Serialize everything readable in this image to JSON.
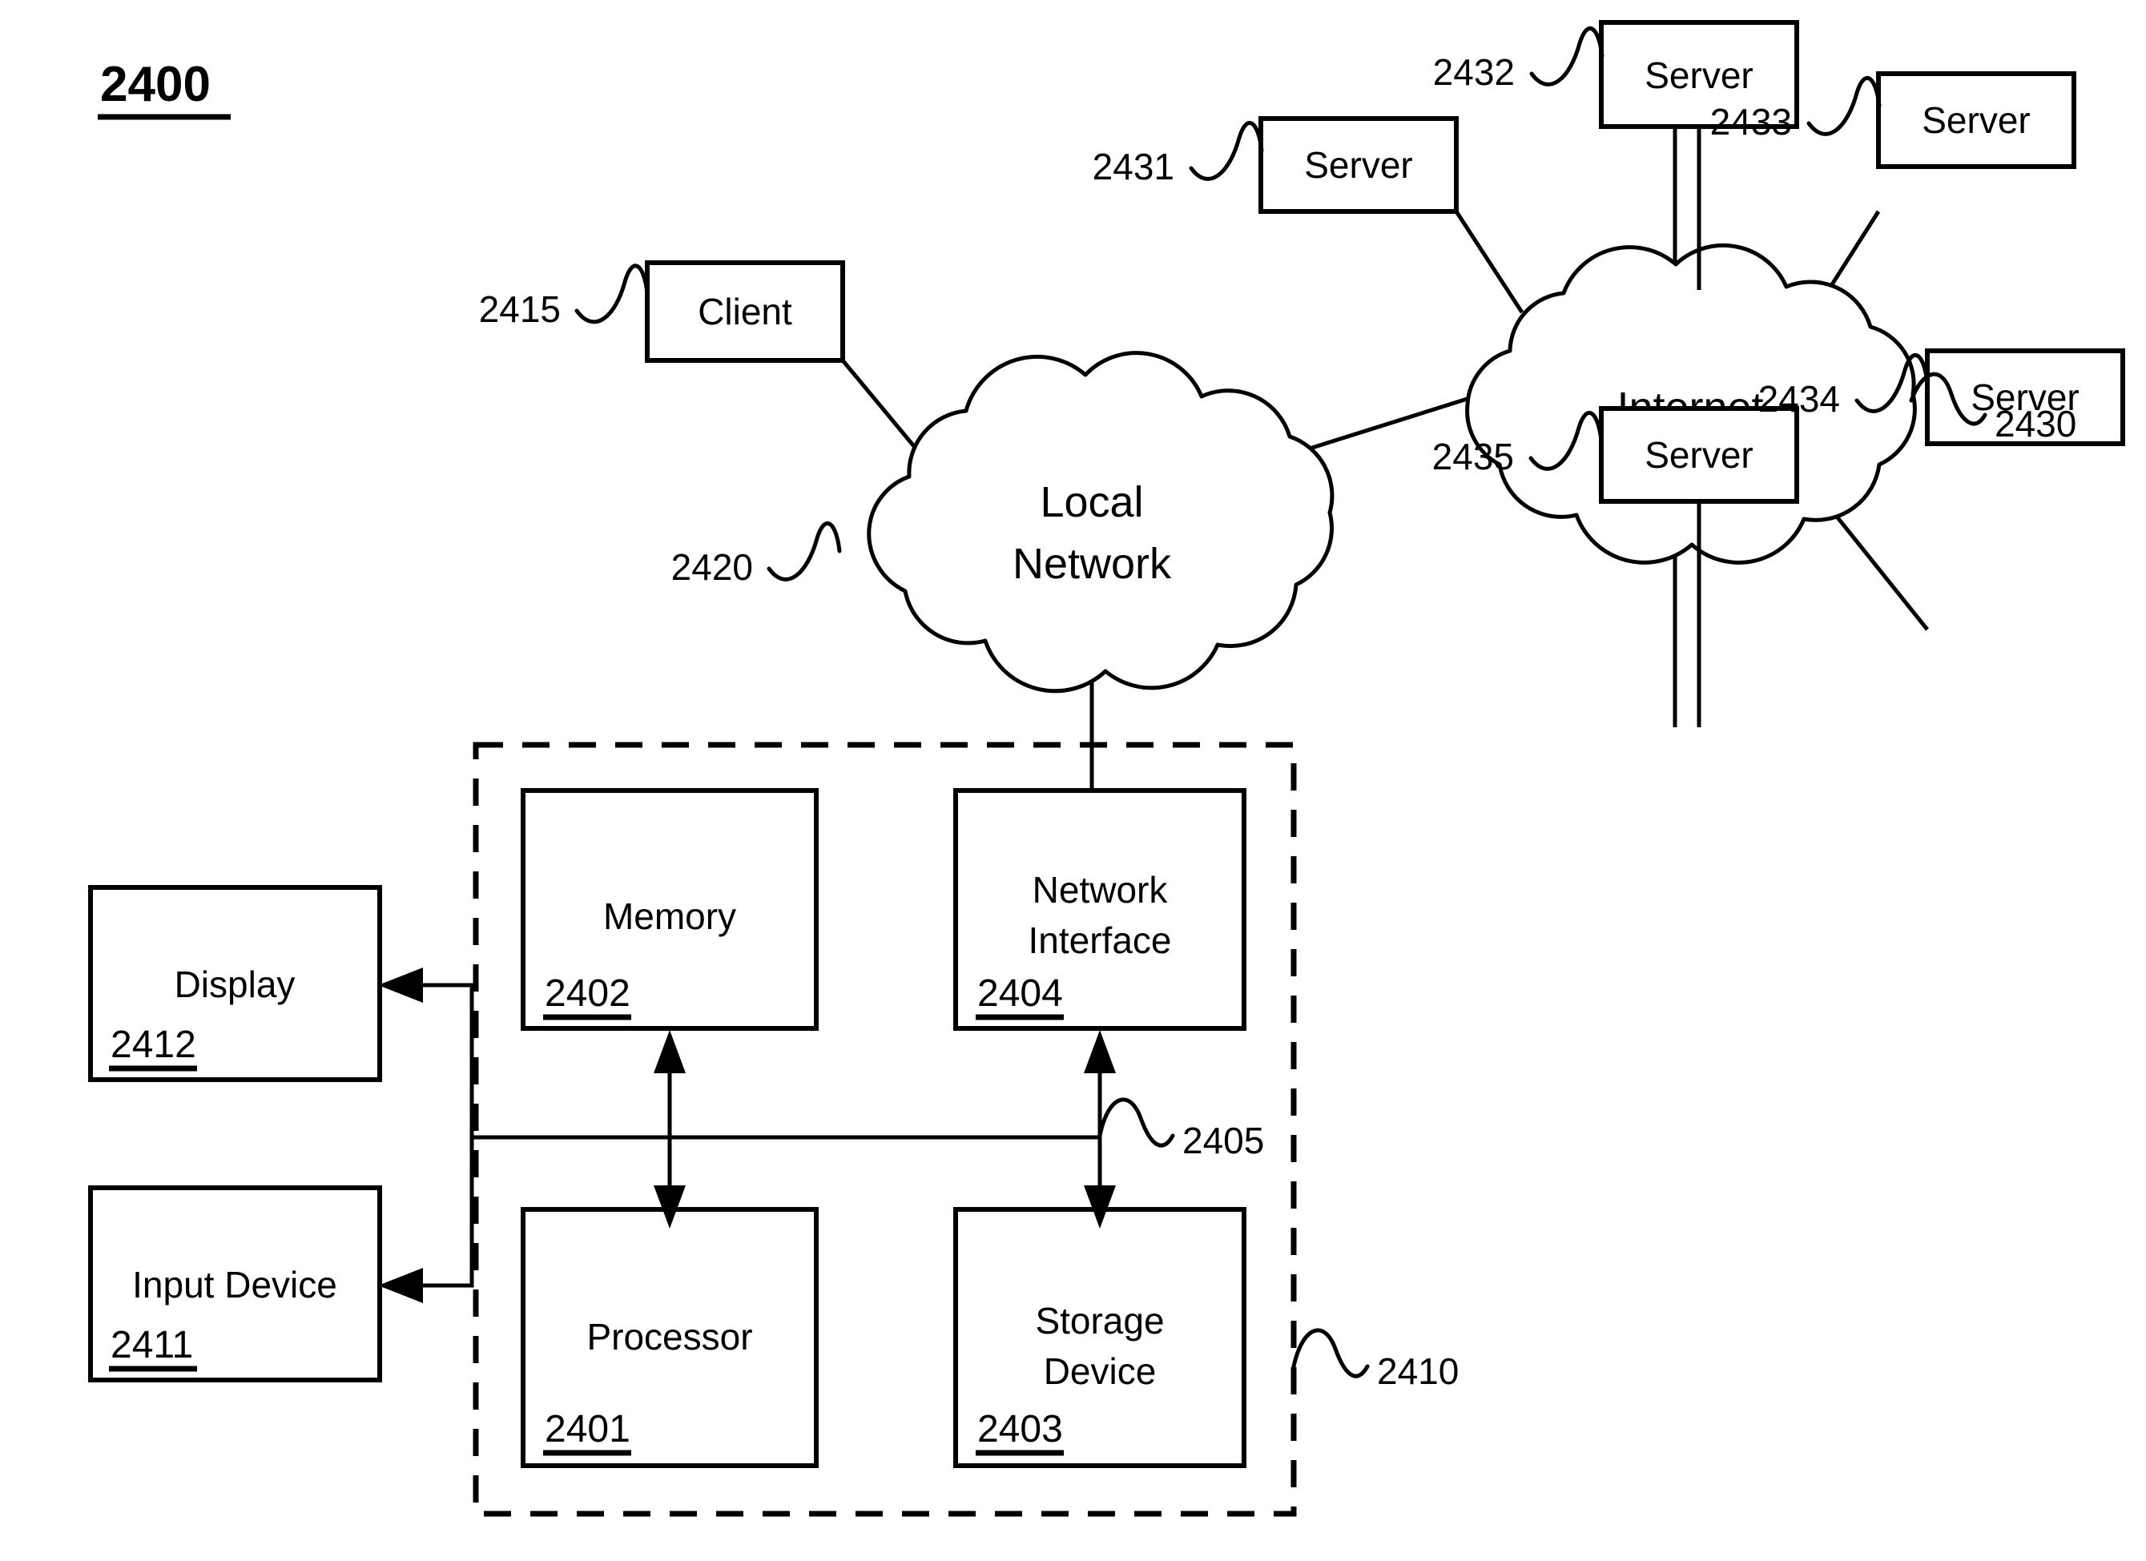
{
  "figure": {
    "number": "2400",
    "kind": "network-and-computer-system-block-diagram"
  },
  "clouds": [
    {
      "id": "local-network",
      "label_line1": "Local",
      "label_line2": "Network",
      "ref": "2420"
    },
    {
      "id": "internet",
      "label_line1": "Internet",
      "label_line2": "",
      "ref": "2430"
    }
  ],
  "nodes": {
    "client": {
      "label": "Client",
      "ref": "2415"
    },
    "servers": [
      {
        "label": "Server",
        "ref": "2431"
      },
      {
        "label": "Server",
        "ref": "2432"
      },
      {
        "label": "Server",
        "ref": "2433"
      },
      {
        "label": "Server",
        "ref": "2434"
      },
      {
        "label": "Server",
        "ref": "2435"
      }
    ]
  },
  "computer_system": {
    "ref": "2410",
    "bus": {
      "ref": "2405"
    },
    "components": [
      {
        "id": "memory",
        "label_line1": "Memory",
        "label_line2": "",
        "ref": "2402"
      },
      {
        "id": "network-interface",
        "label_line1": "Network",
        "label_line2": "Interface",
        "ref": "2404"
      },
      {
        "id": "processor",
        "label_line1": "Processor",
        "label_line2": "",
        "ref": "2401"
      },
      {
        "id": "storage-device",
        "label_line1": "Storage",
        "label_line2": "Device",
        "ref": "2403"
      }
    ]
  },
  "peripherals": [
    {
      "id": "display",
      "label": "Display",
      "ref": "2412"
    },
    {
      "id": "input-device",
      "label": "Input Device",
      "ref": "2411"
    }
  ],
  "colors": {
    "ink": "#000000",
    "paper": "#ffffff"
  }
}
